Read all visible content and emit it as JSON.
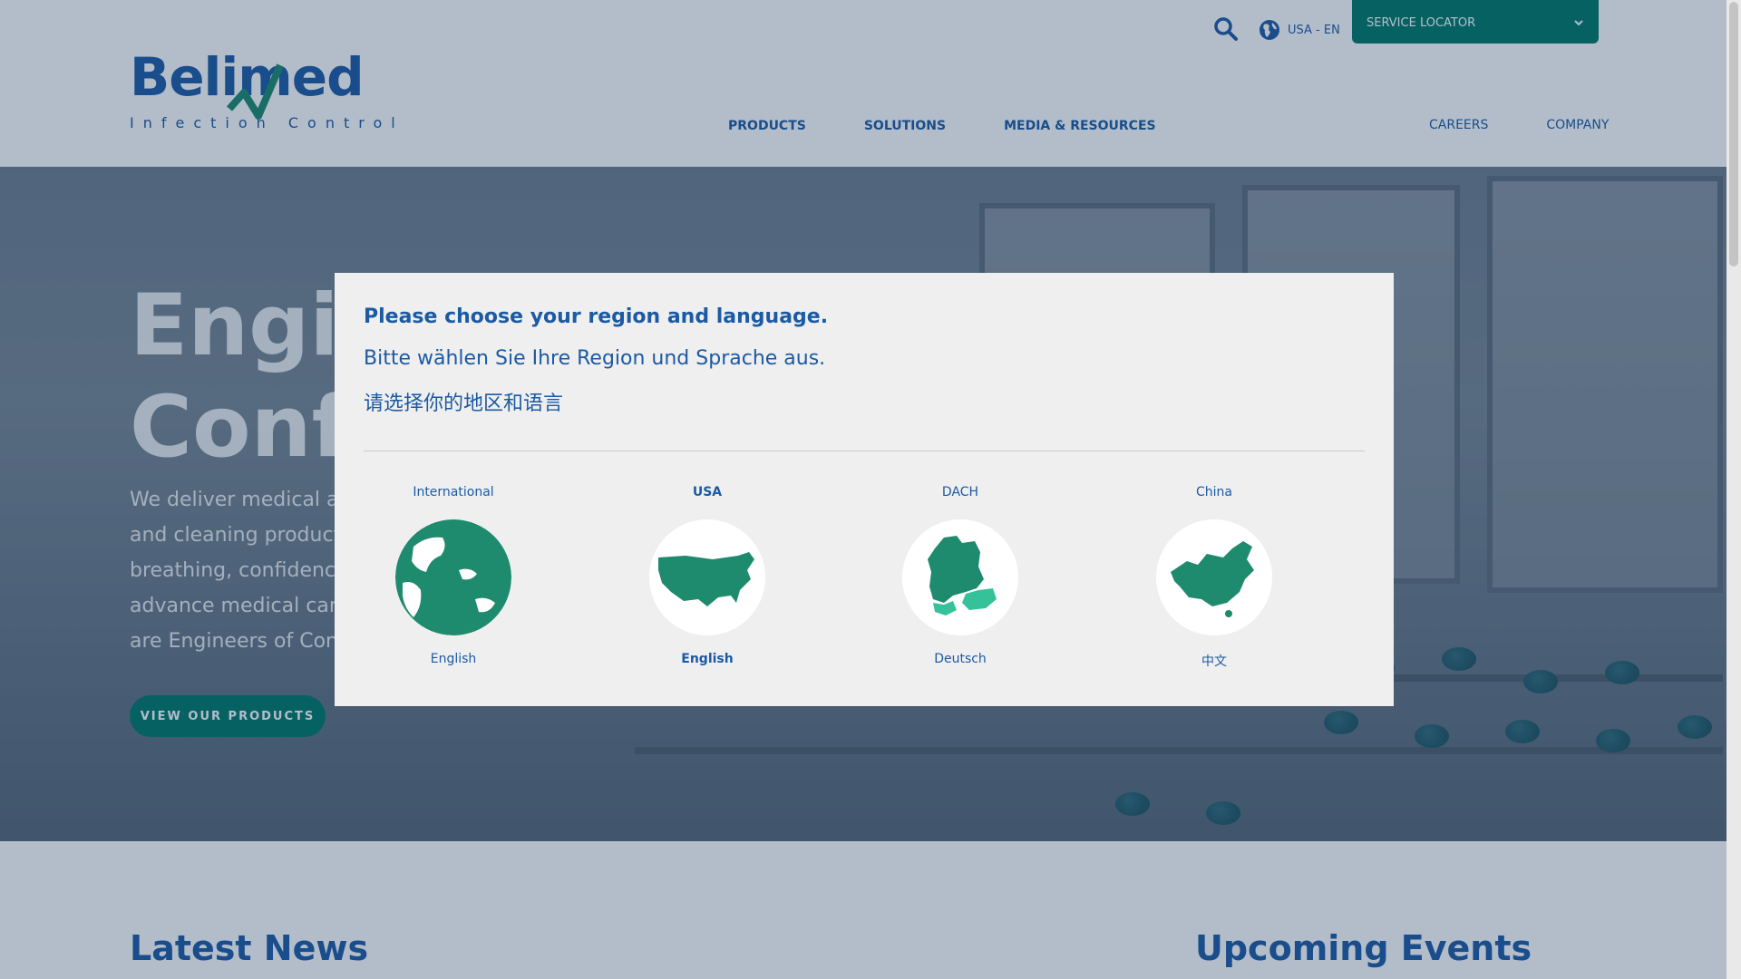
{
  "header": {
    "logo_text": "Belimed",
    "logo_tagline": "Infection Control",
    "language_label": "USA - EN",
    "service_locator_label": "SERVICE LOCATOR",
    "main_nav": [
      "PRODUCTS",
      "SOLUTIONS",
      "MEDIA & RESOURCES"
    ],
    "secondary_nav": [
      "CAREERS",
      "COMPANY"
    ]
  },
  "hero": {
    "title_line1": "Engine",
    "title_line2": "Confid",
    "text": "We deliver medical and s... and cleaning products ar... breathing, confidence wi... advance medical care an... are Engineers of Confide...",
    "text_lines": [
      "We deliver medical and s",
      "and cleaning products ar",
      "breathing, confidence wi",
      "advance medical care an",
      "are Engineers of Confide"
    ],
    "cta_label": "VIEW OUR PRODUCTS"
  },
  "sections": {
    "news_title": "Latest News",
    "events_title": "Upcoming Events"
  },
  "modal": {
    "heading_en": "Please choose your region and language.",
    "heading_de": "Bitte wählen Sie Ihre Region und Sprache aus.",
    "heading_zh": "请选择你的地区和语言",
    "regions": [
      {
        "name": "International",
        "language": "English",
        "active": false,
        "icon": "globe-icon"
      },
      {
        "name": "USA",
        "language": "English",
        "active": true,
        "icon": "usa-map-icon"
      },
      {
        "name": "DACH",
        "language": "Deutsch",
        "active": false,
        "icon": "dach-map-icon"
      },
      {
        "name": "China",
        "language": "中文",
        "active": false,
        "icon": "china-map-icon"
      }
    ]
  },
  "colors": {
    "brand_blue": "#1c5aa3",
    "brand_green": "#007a66",
    "map_green": "#1e8a6e",
    "map_light_green": "#35c29b"
  }
}
